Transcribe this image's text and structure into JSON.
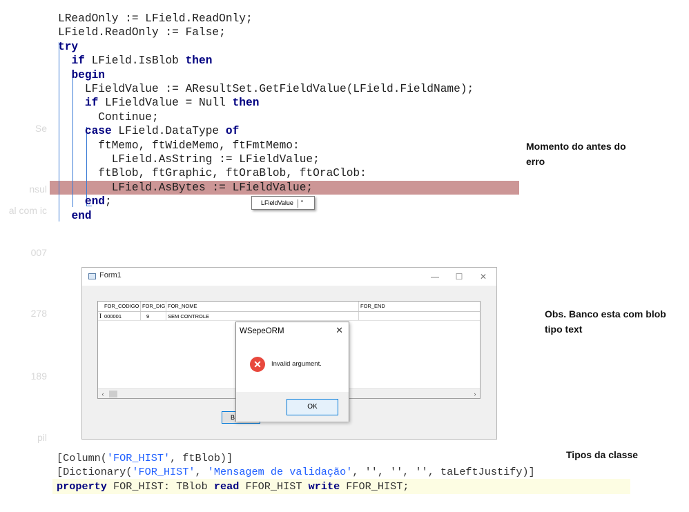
{
  "background_ghost_text": [
    "Se",
    "nsul",
    "al com ic",
    "007",
    "278",
    "189",
    "pil"
  ],
  "code_block_1": {
    "lines": [
      {
        "parts": [
          {
            "t": "LReadOnly := LField.ReadOnly;",
            "k": false
          }
        ]
      },
      {
        "parts": [
          {
            "t": "LField.ReadOnly := False;",
            "k": false
          }
        ]
      },
      {
        "parts": [
          {
            "t": "try",
            "k": true
          }
        ]
      },
      {
        "parts": [
          {
            "t": "  ",
            "k": false
          },
          {
            "t": "if",
            "k": true
          },
          {
            "t": " LField.IsBlob ",
            "k": false
          },
          {
            "t": "then",
            "k": true
          }
        ]
      },
      {
        "parts": [
          {
            "t": "  ",
            "k": false
          },
          {
            "t": "begin",
            "k": true
          }
        ]
      },
      {
        "parts": [
          {
            "t": "    LFieldValue := AResultSet.GetFieldValue(LField.FieldName);",
            "k": false
          }
        ]
      },
      {
        "parts": [
          {
            "t": "    ",
            "k": false
          },
          {
            "t": "if",
            "k": true
          },
          {
            "t": " LFieldValue = Null ",
            "k": false
          },
          {
            "t": "then",
            "k": true
          }
        ]
      },
      {
        "parts": [
          {
            "t": "      Continue;",
            "k": false
          }
        ]
      },
      {
        "parts": [
          {
            "t": "    ",
            "k": false
          },
          {
            "t": "case",
            "k": true
          },
          {
            "t": " LField.DataType ",
            "k": false
          },
          {
            "t": "of",
            "k": true
          }
        ]
      },
      {
        "parts": [
          {
            "t": "      ftMemo, ftWideMemo, ftFmtMemo:",
            "k": false
          }
        ]
      },
      {
        "parts": [
          {
            "t": "        LField.AsString := LFieldValue;",
            "k": false
          }
        ]
      },
      {
        "parts": [
          {
            "t": "      ftBlob, ftGraphic, ftOraBlob, ftOraClob:",
            "k": false
          }
        ]
      },
      {
        "parts": [
          {
            "t": "        LField.AsBytes := LFieldValue;",
            "k": false
          }
        ]
      },
      {
        "parts": [
          {
            "t": "    ",
            "k": false
          },
          {
            "t": "end",
            "k": true
          },
          {
            "t": ";",
            "k": false
          }
        ]
      },
      {
        "parts": [
          {
            "t": "  ",
            "k": false
          },
          {
            "t": "end",
            "k": true
          }
        ]
      }
    ],
    "highlight_color": "#cc9696"
  },
  "tooltip": {
    "name": "LFieldValue",
    "value": "''"
  },
  "notes": {
    "antes": [
      "Momento do antes do",
      "erro"
    ],
    "banco": [
      "Obs. Banco esta com blob",
      "tipo text"
    ],
    "tipos": "Tipos da classe"
  },
  "form": {
    "title": "Form1",
    "controls": {
      "minimize": "—",
      "maximize": "☐",
      "close": "✕"
    },
    "grid": {
      "columns": [
        "FOR_CODIGO",
        "FOR_DIG",
        "FOR_NOME",
        "FOR_END"
      ],
      "indicator": "I",
      "rows": [
        [
          "000001",
          "9",
          "SEM CONTROLE",
          ""
        ]
      ]
    },
    "scroll_left": "‹",
    "scroll_right": "›",
    "button_label": "B"
  },
  "dialog": {
    "title": "WSepeORM",
    "close": "✕",
    "icon": "error-icon",
    "icon_glyph": "✕",
    "message": "Invalid argument.",
    "ok_label": "OK"
  },
  "code_block_2": {
    "line1": {
      "pre": "[Column(",
      "s1": "'FOR_HIST'",
      "post": ", ftBlob)]"
    },
    "line2": {
      "pre": "[Dictionary(",
      "s1": "'FOR_HIST'",
      "mid1": ", ",
      "s2": "'Mensagem de validação'",
      "rest": ", '', '', '', taLeftJustify)]"
    },
    "line3": {
      "k1": "property",
      "a": " FOR_HIST: TBlob ",
      "k2": "read",
      "b": " FFOR_HIST ",
      "k3": "write",
      "c": " FFOR_HIST;"
    }
  },
  "colors": {
    "keyword": "#000080",
    "string": "#1f5fff",
    "dialog_accent": "#0078d7",
    "error_red": "#e8483d"
  }
}
